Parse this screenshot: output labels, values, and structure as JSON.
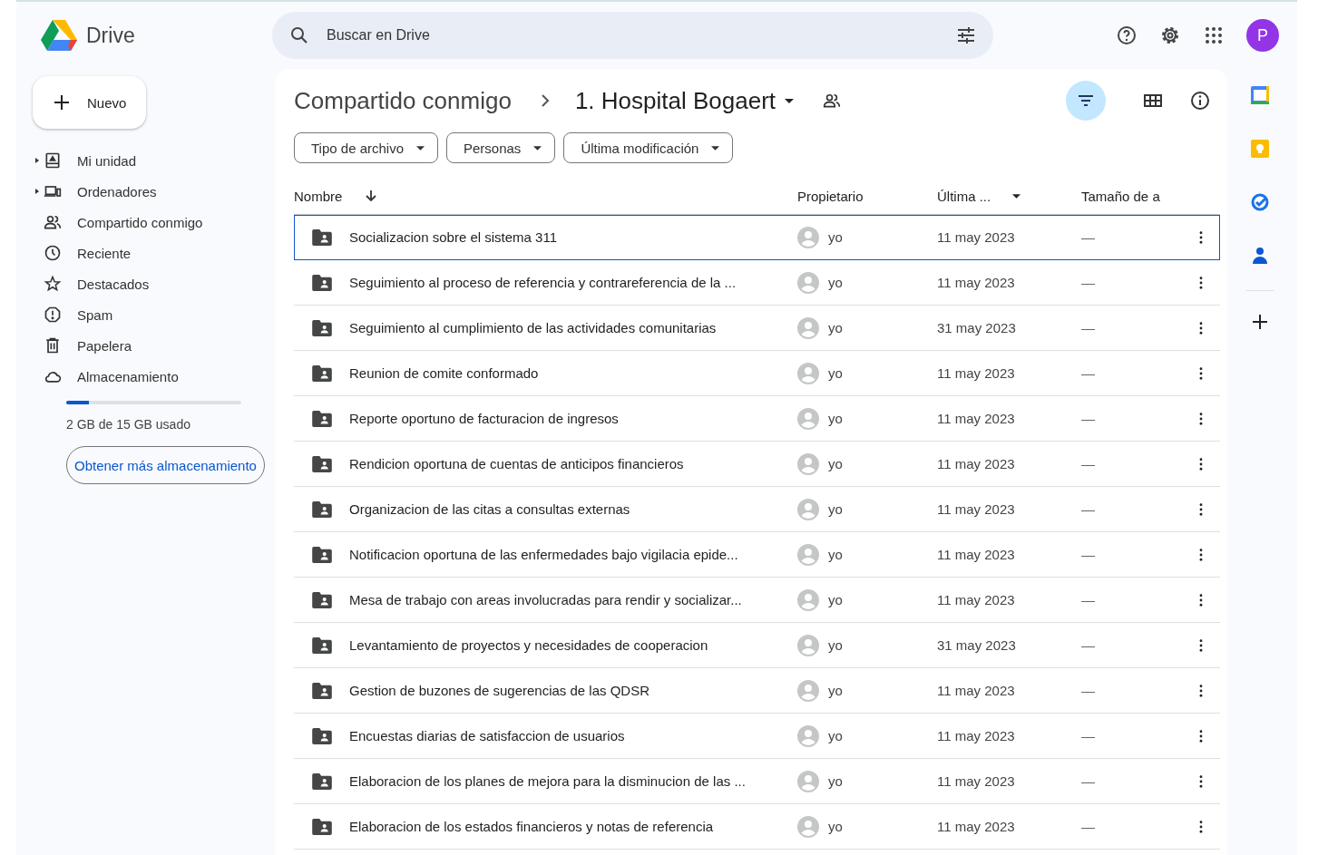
{
  "app": {
    "name": "Drive"
  },
  "search": {
    "placeholder": "Buscar en Drive"
  },
  "account": {
    "initial": "P"
  },
  "new_button": {
    "label": "Nuevo"
  },
  "sidebar": {
    "items": [
      {
        "label": "Mi unidad",
        "expandable": true
      },
      {
        "label": "Ordenadores",
        "expandable": true
      },
      {
        "label": "Compartido conmigo",
        "expandable": false
      },
      {
        "label": "Reciente",
        "expandable": false
      },
      {
        "label": "Destacados",
        "expandable": false
      },
      {
        "label": "Spam",
        "expandable": false
      },
      {
        "label": "Papelera",
        "expandable": false
      },
      {
        "label": "Almacenamiento",
        "expandable": false
      }
    ]
  },
  "storage": {
    "level": 0.13,
    "usage": "2 GB de 15 GB usado",
    "button": "Obtener más almacenamiento"
  },
  "breadcrumb": [
    {
      "label": "Compartido conmigo"
    },
    {
      "label": "1. Hospital Bogaert"
    }
  ],
  "view": {
    "filter_selected": true
  },
  "filters": [
    "Tipo de archivo",
    "Personas",
    "Última modificación"
  ],
  "table": {
    "columns": [
      "Nombre",
      "Propietario",
      "Última ...",
      "Tamaño de a"
    ],
    "rows": [
      {
        "name": "Socializacion sobre el sistema 311",
        "owner": "yo",
        "modified": "11 may 2023",
        "size": "—",
        "selected": true
      },
      {
        "name": "Seguimiento al proceso de referencia y contrareferencia de la ...",
        "owner": "yo",
        "modified": "11 may 2023",
        "size": "—",
        "selected": false
      },
      {
        "name": "Seguimiento al cumplimiento de las actividades comunitarias",
        "owner": "yo",
        "modified": "31 may 2023",
        "size": "—",
        "selected": false
      },
      {
        "name": "Reunion de comite conformado",
        "owner": "yo",
        "modified": "11 may 2023",
        "size": "—",
        "selected": false
      },
      {
        "name": "Reporte oportuno de facturacion de ingresos",
        "owner": "yo",
        "modified": "11 may 2023",
        "size": "—",
        "selected": false
      },
      {
        "name": "Rendicion oportuna de cuentas de anticipos financieros",
        "owner": "yo",
        "modified": "11 may 2023",
        "size": "—",
        "selected": false
      },
      {
        "name": "Organizacion de las citas a consultas externas",
        "owner": "yo",
        "modified": "11 may 2023",
        "size": "—",
        "selected": false
      },
      {
        "name": "Notificacion oportuna de las enfermedades bajo vigilacia epide...",
        "owner": "yo",
        "modified": "11 may 2023",
        "size": "—",
        "selected": false
      },
      {
        "name": "Mesa de trabajo con areas involucradas para rendir y socializar...",
        "owner": "yo",
        "modified": "11 may 2023",
        "size": "—",
        "selected": false
      },
      {
        "name": "Levantamiento de proyectos y necesidades de cooperacion",
        "owner": "yo",
        "modified": "31 may 2023",
        "size": "—",
        "selected": false
      },
      {
        "name": "Gestion de buzones de sugerencias de las QDSR",
        "owner": "yo",
        "modified": "11 may 2023",
        "size": "—",
        "selected": false
      },
      {
        "name": "Encuestas diarias de satisfaccion de usuarios",
        "owner": "yo",
        "modified": "11 may 2023",
        "size": "—",
        "selected": false
      },
      {
        "name": "Elaboracion de los planes de mejora para la disminucion de las ...",
        "owner": "yo",
        "modified": "11 may 2023",
        "size": "—",
        "selected": false
      },
      {
        "name": "Elaboracion de los estados financieros y notas de referencia",
        "owner": "yo",
        "modified": "11 may 2023",
        "size": "—",
        "selected": false
      }
    ]
  }
}
